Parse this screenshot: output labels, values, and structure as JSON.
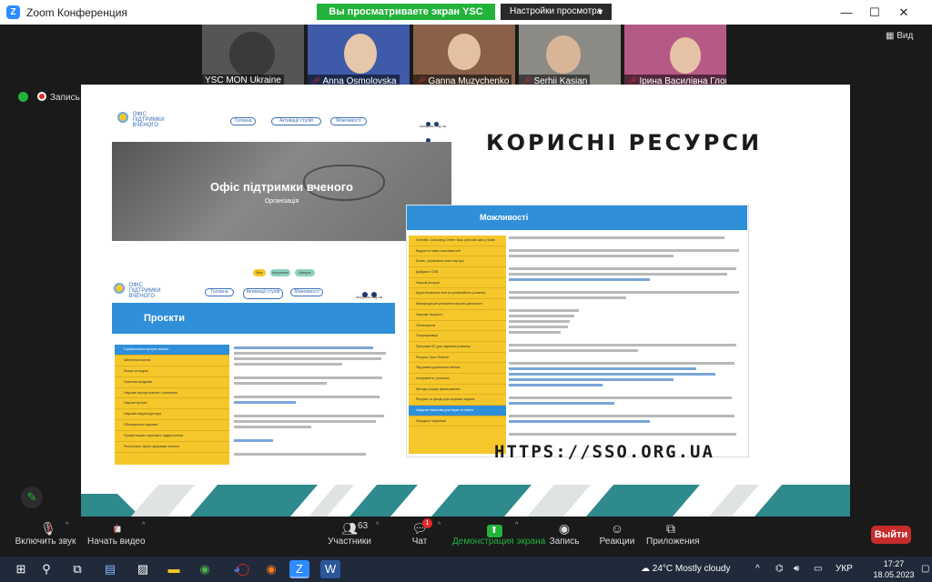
{
  "window": {
    "app_icon": "zoom-icon",
    "title": "Zoom Конференция",
    "share_banner": "Вы просматриваете экран YSC MON Ukraine",
    "view_settings": "Настройки просмотра",
    "controls": [
      "—",
      "☐",
      "✕"
    ]
  },
  "participants": [
    {
      "name": "YSC MON Ukraine",
      "muted": false,
      "bg": "#b9b9b6"
    },
    {
      "name": "Anna Osmolovska",
      "muted": true,
      "bg": "#3e5aa8"
    },
    {
      "name": "Ganna Muzychenko",
      "muted": true,
      "bg": "#8a6048"
    },
    {
      "name": "Serhii Kasian",
      "muted": true,
      "bg": "#8c8a85"
    },
    {
      "name": "Ірина Василівна Глов...",
      "muted": true,
      "bg": "#b55a86"
    }
  ],
  "view_button": "Вид",
  "recording_label": "Запись",
  "slide": {
    "title": "КОРИСНІ РЕСУРСИ",
    "url": "HTTPS://SSO.ORG.UA",
    "hero": {
      "org": "Офіс підтримки вченого",
      "subtitle": "Організація",
      "logo_text": [
        "ОФІС",
        "ПІДТРИМКИ",
        "ВЧЕНОГО"
      ],
      "nav": [
        "Головна",
        "Активації стулій",
        "Можливості"
      ],
      "email": "sso@sso.org.ua"
    },
    "possibilities": {
      "heading": "Можливості",
      "items": [
        "Scientific Consulting Center: Ваш робочий офіс у Києві",
        "Відкриття нових можливостей",
        "Бізнес, управління нової кар'єри",
        "Дайджест ОПВ",
        "Наукові ресурси",
        "Курси іноземних мов та професійного розвитку",
        "Міжнародні регулювання наукової діяльності",
        "Наукова творчість",
        "Обговорення",
        "Популяризація",
        "Програми ЄС для наукових розвитку",
        "Ресурси Open Science",
        "Підтримка українських вчених",
        "Інструменти і розвиток",
        "Методи пошуку фінансування",
        "Ресурси та фонди для наукових видань",
        "Цифрові ініціативи для науки та освіти",
        "Юридичні підтримки"
      ],
      "active_index": 16
    },
    "projects": {
      "heading": "Проєкти",
      "email": "sso@sso.org.ua",
      "pills": [
        "Все",
        "Актуальні",
        "Минулі"
      ],
      "nav": [
        "Головна",
        "Активації стулій",
        "Можливості"
      ],
      "logo_text": [
        "ОФІС",
        "ПІДТРИМКИ",
        "ВЧЕНОГО"
      ],
      "items": [
        "Горизонтальні зустрічі вчених",
        "Бібліотека вчених",
        "Кошик за водою",
        "Грантова академія",
        "Наукова кар'єра вчених і освітянам",
        "Наукові зустрічі",
        "Наукова інфраструктура",
        "Обговорення наукових",
        "Просвітництво наукового підкреслення",
        "Регіональні офіси підтримки вченого"
      ],
      "active_index": 0
    }
  },
  "toolbar": {
    "mic": "Включить звук",
    "video": "Начать видео",
    "participants": "Участники",
    "participants_count": "63",
    "chat": "Чат",
    "chat_badge": "1",
    "share": "Демонстрация экрана",
    "record": "Запись",
    "reactions": "Реакции",
    "apps": "Приложения",
    "leave": "Выйти"
  },
  "taskbar": {
    "weather": "24°C Mostly cloudy",
    "lang": "УКР",
    "time": "17:27",
    "date": "18.05.2023"
  },
  "colors": {
    "accent_green": "#23b33a",
    "zoom_blue": "#2d8cff",
    "leave_red": "#c62c2c",
    "slide_blue": "#2f8fd9",
    "slide_yellow": "#f5c72a",
    "teal": "#2e8a8c"
  }
}
